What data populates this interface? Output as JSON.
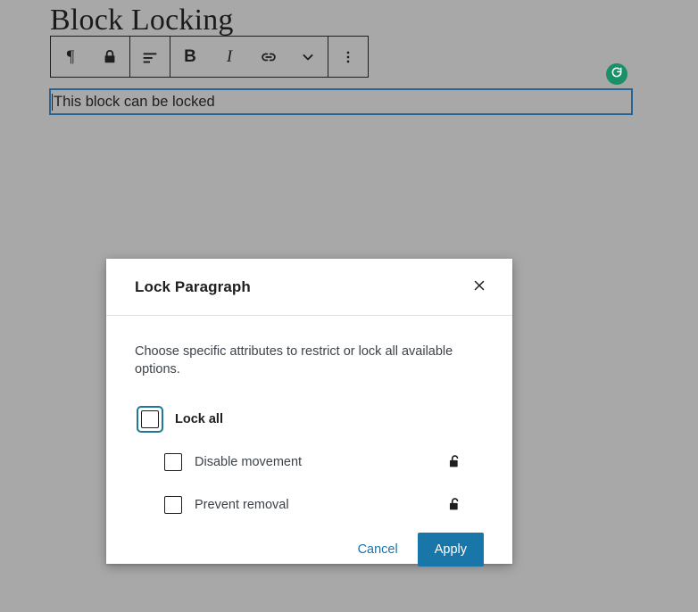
{
  "editor": {
    "post_title": "Block Locking",
    "toolbar": {
      "groups": [
        {
          "buttons": [
            {
              "name": "block-type-paragraph-button",
              "icon": "paragraph-pilcrow-icon",
              "label": "¶"
            },
            {
              "name": "block-lock-button",
              "icon": "lock-closed-icon",
              "label": "Lock"
            }
          ]
        },
        {
          "buttons": [
            {
              "name": "align-text-button",
              "icon": "align-left-icon",
              "label": "Align text"
            }
          ]
        },
        {
          "buttons": [
            {
              "name": "bold-button",
              "icon": "bold-icon",
              "label": "B"
            },
            {
              "name": "italic-button",
              "icon": "italic-icon",
              "label": "I"
            },
            {
              "name": "link-button",
              "icon": "link-icon",
              "label": "Link"
            },
            {
              "name": "more-rich-text-button",
              "icon": "chevron-down-icon",
              "label": "More"
            }
          ]
        },
        {
          "buttons": [
            {
              "name": "block-options-button",
              "icon": "vertical-dots-icon",
              "label": "Options"
            }
          ]
        }
      ]
    },
    "paragraph_block": {
      "text": "This block can be locked",
      "selected_border_color": "#2a6496"
    },
    "badge": {
      "name": "refresh-status-badge",
      "icon": "circular-arrow-icon",
      "color": "#1a9069"
    },
    "background_color": "#a8a8a8"
  },
  "modal": {
    "title": "Lock Paragraph",
    "close_label": "×",
    "description": "Choose specific attributes to restrict or lock all available options.",
    "lock_all": {
      "label": "Lock all",
      "checked": false,
      "focused": true,
      "focus_ring_color": "#1b7a96"
    },
    "options": [
      {
        "label": "Disable movement",
        "checked": false,
        "icon": "lock-open-icon"
      },
      {
        "label": "Prevent removal",
        "checked": false,
        "icon": "lock-open-icon"
      }
    ],
    "footer": {
      "cancel_label": "Cancel",
      "apply_label": "Apply",
      "accent_color": "#1976a8"
    }
  }
}
